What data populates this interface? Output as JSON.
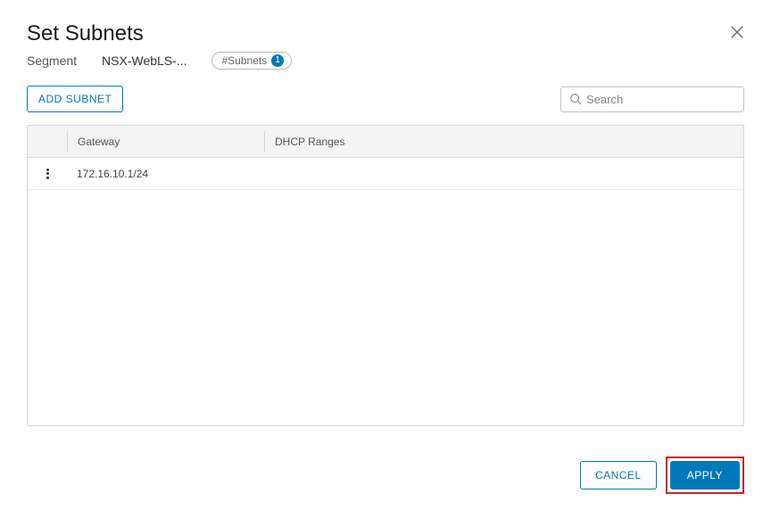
{
  "dialog": {
    "title": "Set Subnets",
    "segment_label": "Segment",
    "segment_value": "NSX-WebLS-...",
    "pill_label": "#Subnets",
    "pill_count": "1"
  },
  "toolbar": {
    "add_subnet_label": "ADD SUBNET",
    "search_placeholder": "Search"
  },
  "table": {
    "headers": {
      "gateway": "Gateway",
      "dhcp": "DHCP Ranges"
    },
    "rows": [
      {
        "gateway": "172.16.10.1/24",
        "dhcp": ""
      }
    ]
  },
  "footer": {
    "cancel_label": "CANCEL",
    "apply_label": "APPLY"
  }
}
